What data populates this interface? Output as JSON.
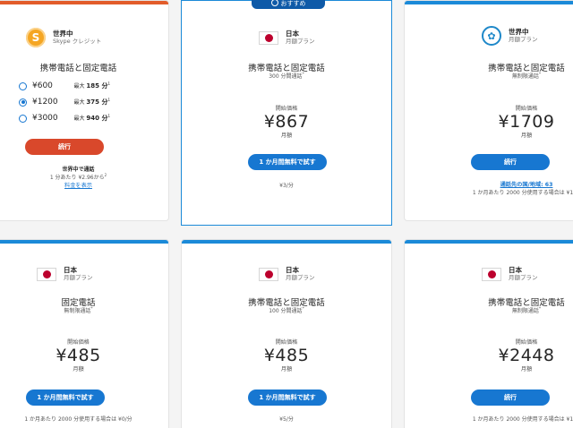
{
  "colors": {
    "accent_blue": "#1777d1",
    "accent_red": "#d9482b",
    "bar_orange": "#e25c2a",
    "bar_blue": "#1b8ad8"
  },
  "card1": {
    "name": "世界中",
    "type": "Skype クレジット",
    "title": "携帯電話と固定電話",
    "options": [
      {
        "amount": "¥600",
        "max_label": "最大",
        "max_value": "185 分",
        "note": "1",
        "selected": false
      },
      {
        "amount": "¥1200",
        "max_label": "最大",
        "max_value": "375 分",
        "note": "1",
        "selected": true
      },
      {
        "amount": "¥3000",
        "max_label": "最大",
        "max_value": "940 分",
        "note": "1",
        "selected": false
      }
    ],
    "button": "続行",
    "foot1": "世界中で通話",
    "foot2": "1 分あたり ¥2.96から",
    "foot2_note": "2",
    "link": "料金を表示"
  },
  "card2": {
    "badge": "おすすめ",
    "country": "日本",
    "plan": "月額プラン",
    "title": "携帯電話と固定電話",
    "sub": "300 分間通話",
    "sub_note": "*",
    "start_label": "開始価格",
    "price": "¥867",
    "period": "月額",
    "button": "1 か月間無料で試す",
    "foot": "¥3/分"
  },
  "card3": {
    "name": "世界中",
    "plan": "月額プラン",
    "title": "携帯電話と固定電話",
    "sub": "無制限通話",
    "sub_note": "*",
    "start_label": "開始価格",
    "price": "¥1709",
    "period": "月額",
    "button": "続行",
    "link": "通話先の国/地域: 63",
    "foot": "1 か月あたり 2000 分使用する場合は ¥1/分"
  },
  "card4": {
    "country": "日本",
    "plan": "月額プラン",
    "title": "固定電話",
    "sub": "無制限通話",
    "sub_note": "*",
    "start_label": "開始価格",
    "price": "¥485",
    "period": "月額",
    "button": "1 か月間無料で試す",
    "foot": "1 か月あたり 2000 分使用する場合は ¥0/分"
  },
  "card5": {
    "country": "日本",
    "plan": "月額プラン",
    "title": "携帯電話と固定電話",
    "sub": "100 分間通話",
    "sub_note": "*",
    "start_label": "開始価格",
    "price": "¥485",
    "period": "月額",
    "button": "1 か月間無料で試す",
    "foot": "¥5/分"
  },
  "card6": {
    "country": "日本",
    "plan": "月額プラン",
    "title": "携帯電話と固定電話",
    "sub": "無制限通話",
    "sub_note": "*",
    "start_label": "開始価格",
    "price": "¥2448",
    "period": "月額",
    "button": "続行",
    "foot": "1 か月あたり 2000 分使用する場合は ¥1/分"
  }
}
